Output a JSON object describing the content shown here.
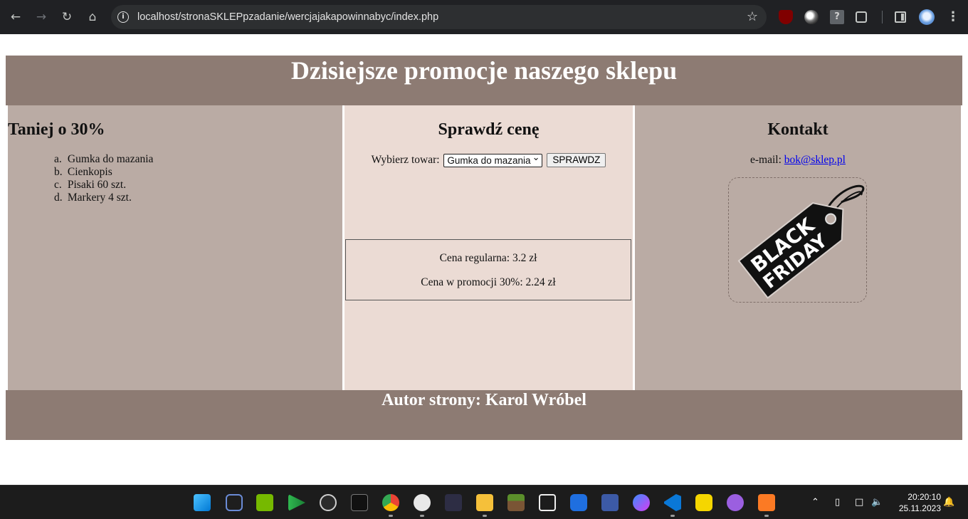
{
  "browser": {
    "url": "localhost/stronaSKLEPpzadanie/wercjajakapowinnabyc/index.php"
  },
  "page": {
    "header_title": "Dzisiejsze promocje naszego sklepu",
    "left": {
      "heading": "Taniej o 30%",
      "items": [
        {
          "marker": "a.",
          "label": "Gumka do mazania"
        },
        {
          "marker": "b.",
          "label": "Cienkopis"
        },
        {
          "marker": "c.",
          "label": "Pisaki 60 szt."
        },
        {
          "marker": "d.",
          "label": "Markery 4 szt."
        }
      ]
    },
    "middle": {
      "heading": "Sprawdź cenę",
      "select_label": "Wybierz towar:",
      "select_value": "Gumka do mazania",
      "button_label": "SPRAWDZ",
      "regular_price": "Cena regularna: 3.2 zł",
      "promo_price": "Cena w promocji 30%: 2.24 zł"
    },
    "right": {
      "heading": "Kontakt",
      "email_label": "e-mail:",
      "email": "bok@sklep.pl",
      "image_text_line1": "BLACK",
      "image_text_line2": "FRIDAY"
    },
    "footer": "Autor strony: Karol Wróbel"
  },
  "taskbar": {
    "time": "20:20:10",
    "date": "25.11.2023",
    "icons": [
      "windows-start",
      "camera",
      "nvidia",
      "media-player",
      "wattpad",
      "epic-games",
      "chrome",
      "obs",
      "terminal",
      "file-explorer",
      "minecraft",
      "notion",
      "ccleaner",
      "network-tool",
      "messenger",
      "vscode",
      "checkmark-app",
      "play-app",
      "xampp"
    ]
  },
  "colors": {
    "header_bg": "#8d7b73",
    "side_bg": "#baaba4",
    "middle_bg": "#ebdbd4"
  }
}
